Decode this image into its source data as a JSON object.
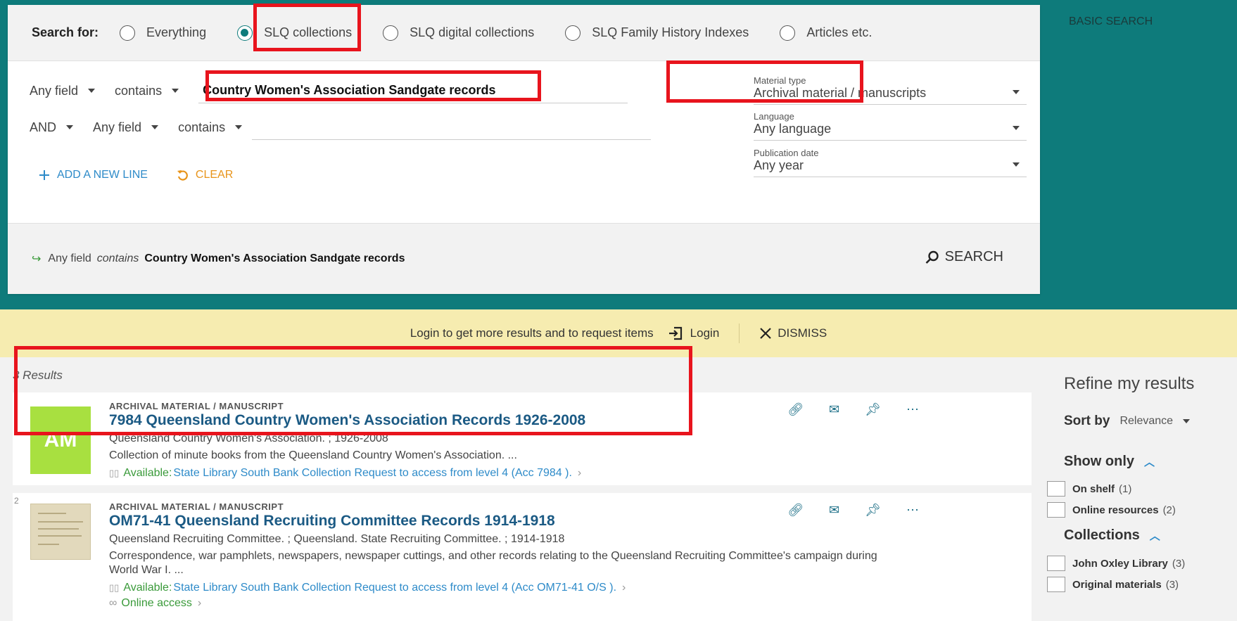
{
  "search": {
    "label": "Search for:",
    "options": [
      "Everything",
      "SLQ collections",
      "SLQ digital collections",
      "SLQ Family History Indexes",
      "Articles etc."
    ],
    "selected": "SLQ collections",
    "row1": {
      "field": "Any field",
      "op": "contains",
      "value": "Country Women's Association Sandgate records"
    },
    "row2": {
      "bool": "AND",
      "field": "Any field",
      "op": "contains",
      "value": ""
    },
    "material": {
      "label": "Material type",
      "value": "Archival material / manuscripts"
    },
    "language": {
      "label": "Language",
      "value": "Any language"
    },
    "pubdate": {
      "label": "Publication date",
      "value": "Any year"
    },
    "add_line": "ADD A NEW LINE",
    "clear": "CLEAR",
    "query_field": "Any field",
    "query_op": "contains",
    "query_value": "Country Women's Association Sandgate records",
    "search_button": "SEARCH",
    "basic_search": "BASIC SEARCH"
  },
  "login": {
    "message": "Login to get more results and to request items",
    "login_label": "Login",
    "dismiss": "DISMISS"
  },
  "results": {
    "count": "3 Results",
    "items": [
      {
        "thumb": "AM",
        "type": "ARCHIVAL MATERIAL / MANUSCRIPT",
        "title": "7984 Queensland Country Women's Association Records 1926-2008",
        "line1": "Queensland Country Women's Association. ; 1926-2008",
        "line2": "Collection of minute books from the Queensland Country Women's Association. ...",
        "avail": "Available:",
        "location": "State Library South Bank Collection  Request to access from level 4 (Acc 7984 )."
      },
      {
        "number": "2",
        "type": "ARCHIVAL MATERIAL / MANUSCRIPT",
        "title": "OM71-41 Queensland Recruiting Committee Records 1914-1918",
        "line1": "Queensland Recruiting Committee. ; Queensland. State Recruiting Committee. ; 1914-1918",
        "line2": "Correspondence, war pamphlets, newspapers, newspaper cuttings, and other records relating to the Queensland Recruiting Committee's campaign during World War I. ...",
        "avail": "Available:",
        "location": "State Library South Bank Collection  Request to access from level 4 (Acc OM71-41 O/S ).",
        "online": "Online access"
      }
    ]
  },
  "refine": {
    "title": "Refine my results",
    "sort_label": "Sort by",
    "sort_value": "Relevance",
    "show_only": "Show only",
    "on_shelf": "On shelf",
    "on_shelf_count": "(1)",
    "online_resources": "Online resources",
    "online_resources_count": "(2)",
    "collections": "Collections",
    "john_oxley": "John Oxley Library",
    "john_oxley_count": "(3)",
    "original": "Original materials",
    "original_count": "(3)"
  },
  "colors": {
    "teal": "#0e7b7b",
    "highlight": "#e8141d",
    "link": "#1b5a84",
    "banner": "#f6ecb0"
  }
}
